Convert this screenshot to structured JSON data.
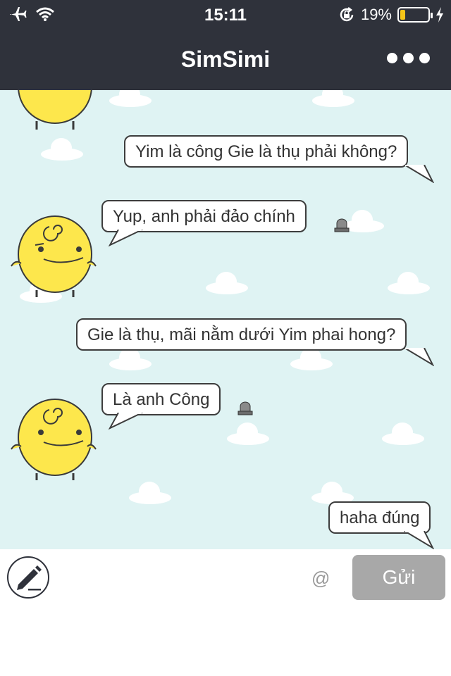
{
  "status_bar": {
    "time": "15:11",
    "battery_percent": "19%",
    "battery_level": 0.19,
    "battery_color": "#f5c518"
  },
  "header": {
    "title": "SimSimi",
    "background": "#2f323b",
    "menu_icon": "more-dots-icon"
  },
  "chat": {
    "background": "#dff3f3",
    "messages": [
      {
        "sender": "user",
        "text": "Yim là công Gie là thụ phải không?"
      },
      {
        "sender": "simsimi",
        "text": "Yup, anh phải đảo chính"
      },
      {
        "sender": "user",
        "text": "Gie là thụ, mãi nằm dưới Yim phai hong?"
      },
      {
        "sender": "simsimi",
        "text": "Là anh Công"
      },
      {
        "sender": "user",
        "text": "haha đúng"
      }
    ]
  },
  "input_bar": {
    "pen_icon": "pencil-icon",
    "at_symbol": "@",
    "send_label": "Gửi"
  }
}
